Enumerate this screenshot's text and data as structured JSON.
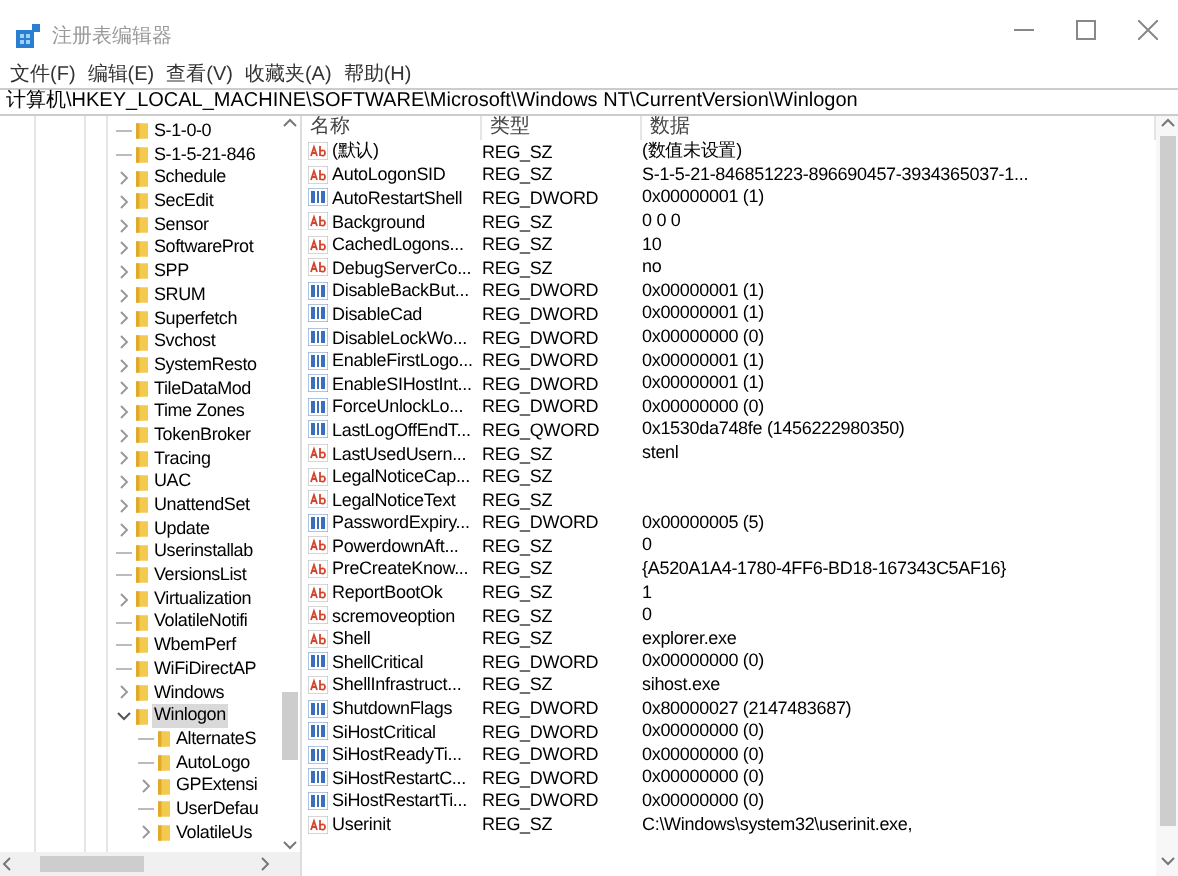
{
  "window": {
    "title": "注册表编辑器"
  },
  "menu": [
    "文件(F)",
    "编辑(E)",
    "查看(V)",
    "收藏夹(A)",
    "帮助(H)"
  ],
  "address": "计算机\\HKEY_LOCAL_MACHINE\\SOFTWARE\\Microsoft\\Windows NT\\CurrentVersion\\Winlogon",
  "tree": [
    {
      "label": "S-1-0-0",
      "expandable": false,
      "selected": false
    },
    {
      "label": "S-1-5-21-846",
      "expandable": false,
      "selected": false
    },
    {
      "label": "Schedule",
      "expandable": true,
      "selected": false
    },
    {
      "label": "SecEdit",
      "expandable": true,
      "selected": false
    },
    {
      "label": "Sensor",
      "expandable": true,
      "selected": false
    },
    {
      "label": "SoftwareProt",
      "expandable": true,
      "selected": false
    },
    {
      "label": "SPP",
      "expandable": true,
      "selected": false
    },
    {
      "label": "SRUM",
      "expandable": true,
      "selected": false
    },
    {
      "label": "Superfetch",
      "expandable": true,
      "selected": false
    },
    {
      "label": "Svchost",
      "expandable": true,
      "selected": false
    },
    {
      "label": "SystemResto",
      "expandable": true,
      "selected": false
    },
    {
      "label": "TileDataMod",
      "expandable": true,
      "selected": false
    },
    {
      "label": "Time Zones",
      "expandable": true,
      "selected": false
    },
    {
      "label": "TokenBroker",
      "expandable": true,
      "selected": false
    },
    {
      "label": "Tracing",
      "expandable": true,
      "selected": false
    },
    {
      "label": "UAC",
      "expandable": true,
      "selected": false
    },
    {
      "label": "UnattendSet",
      "expandable": true,
      "selected": false
    },
    {
      "label": "Update",
      "expandable": true,
      "selected": false
    },
    {
      "label": "Userinstallab",
      "expandable": false,
      "selected": false
    },
    {
      "label": "VersionsList",
      "expandable": false,
      "selected": false
    },
    {
      "label": "Virtualization",
      "expandable": true,
      "selected": false
    },
    {
      "label": "VolatileNotifi",
      "expandable": false,
      "selected": false
    },
    {
      "label": "WbemPerf",
      "expandable": false,
      "selected": false
    },
    {
      "label": "WiFiDirectAP",
      "expandable": false,
      "selected": false
    },
    {
      "label": "Windows",
      "expandable": true,
      "selected": false
    },
    {
      "label": "Winlogon",
      "expandable": true,
      "expanded": true,
      "selected": true,
      "children": [
        {
          "label": "AlternateS",
          "expandable": false,
          "selected": false
        },
        {
          "label": "AutoLogo",
          "expandable": false,
          "selected": false
        },
        {
          "label": "GPExtensi",
          "expandable": true,
          "selected": false
        },
        {
          "label": "UserDefau",
          "expandable": false,
          "selected": false
        },
        {
          "label": "VolatileUs",
          "expandable": true,
          "selected": false
        }
      ]
    }
  ],
  "table": {
    "columns": [
      "名称",
      "类型",
      "数据"
    ],
    "rows": [
      {
        "kind": "string",
        "name": "(默认)",
        "type": "REG_SZ",
        "data": "(数值未设置)"
      },
      {
        "kind": "string",
        "name": "AutoLogonSID",
        "type": "REG_SZ",
        "data": "S-1-5-21-846851223-896690457-3934365037-1..."
      },
      {
        "kind": "binary",
        "name": "AutoRestartShell",
        "type": "REG_DWORD",
        "data": "0x00000001 (1)"
      },
      {
        "kind": "string",
        "name": "Background",
        "type": "REG_SZ",
        "data": "0 0 0"
      },
      {
        "kind": "string",
        "name": "CachedLogons...",
        "type": "REG_SZ",
        "data": "10"
      },
      {
        "kind": "string",
        "name": "DebugServerCo...",
        "type": "REG_SZ",
        "data": "no"
      },
      {
        "kind": "binary",
        "name": "DisableBackBut...",
        "type": "REG_DWORD",
        "data": "0x00000001 (1)"
      },
      {
        "kind": "binary",
        "name": "DisableCad",
        "type": "REG_DWORD",
        "data": "0x00000001 (1)"
      },
      {
        "kind": "binary",
        "name": "DisableLockWo...",
        "type": "REG_DWORD",
        "data": "0x00000000 (0)"
      },
      {
        "kind": "binary",
        "name": "EnableFirstLogo...",
        "type": "REG_DWORD",
        "data": "0x00000001 (1)"
      },
      {
        "kind": "binary",
        "name": "EnableSIHostInt...",
        "type": "REG_DWORD",
        "data": "0x00000001 (1)"
      },
      {
        "kind": "binary",
        "name": "ForceUnlockLo...",
        "type": "REG_DWORD",
        "data": "0x00000000 (0)"
      },
      {
        "kind": "binary",
        "name": "LastLogOffEndT...",
        "type": "REG_QWORD",
        "data": "0x1530da748fe (1456222980350)"
      },
      {
        "kind": "string",
        "name": "LastUsedUsern...",
        "type": "REG_SZ",
        "data": "stenl"
      },
      {
        "kind": "string",
        "name": "LegalNoticeCap...",
        "type": "REG_SZ"
      },
      {
        "kind": "string",
        "name": "LegalNoticeText",
        "type": "REG_SZ"
      },
      {
        "kind": "binary",
        "name": "PasswordExpiry...",
        "type": "REG_DWORD",
        "data": "0x00000005 (5)"
      },
      {
        "kind": "string",
        "name": "PowerdownAft...",
        "type": "REG_SZ",
        "data": "0"
      },
      {
        "kind": "string",
        "name": "PreCreateKnow...",
        "type": "REG_SZ",
        "data": "{A520A1A4-1780-4FF6-BD18-167343C5AF16}"
      },
      {
        "kind": "string",
        "name": "ReportBootOk",
        "type": "REG_SZ",
        "data": "1"
      },
      {
        "kind": "string",
        "name": "scremoveoption",
        "type": "REG_SZ",
        "data": "0"
      },
      {
        "kind": "string",
        "name": "Shell",
        "type": "REG_SZ",
        "data": "explorer.exe"
      },
      {
        "kind": "binary",
        "name": "ShellCritical",
        "type": "REG_DWORD",
        "data": "0x00000000 (0)"
      },
      {
        "kind": "string",
        "name": "ShellInfrastruct...",
        "type": "REG_SZ",
        "data": "sihost.exe"
      },
      {
        "kind": "binary",
        "name": "ShutdownFlags",
        "type": "REG_DWORD",
        "data": "0x80000027 (2147483687)"
      },
      {
        "kind": "binary",
        "name": "SiHostCritical",
        "type": "REG_DWORD",
        "data": "0x00000000 (0)"
      },
      {
        "kind": "binary",
        "name": "SiHostReadyTi...",
        "type": "REG_DWORD",
        "data": "0x00000000 (0)"
      },
      {
        "kind": "binary",
        "name": "SiHostRestartC...",
        "type": "REG_DWORD",
        "data": "0x00000000 (0)"
      },
      {
        "kind": "binary",
        "name": "SiHostRestartTi...",
        "type": "REG_DWORD",
        "data": "0x00000000 (0)"
      },
      {
        "kind": "string",
        "name": "Userinit",
        "type": "REG_SZ",
        "data": "C:\\Windows\\system32\\userinit.exe,"
      }
    ]
  }
}
